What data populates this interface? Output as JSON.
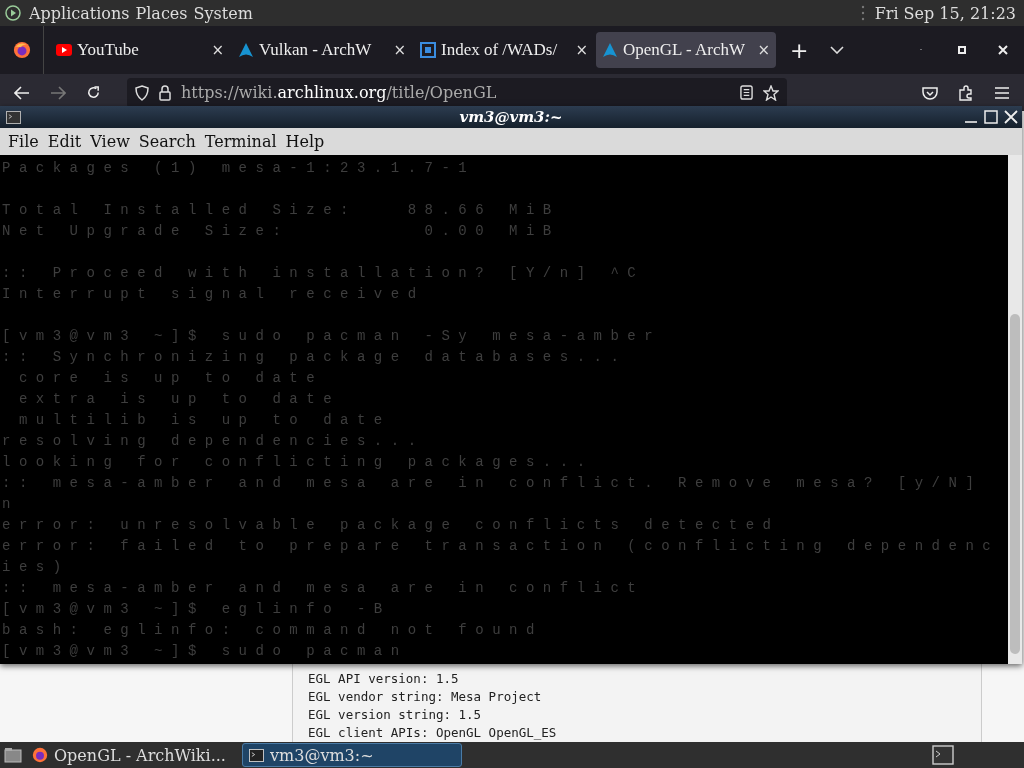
{
  "top_panel": {
    "menus": [
      "Applications",
      "Places",
      "System"
    ],
    "clock": "Fri Sep 15, 21:23"
  },
  "browser": {
    "tabs": [
      {
        "title": "YouTube",
        "selected": false
      },
      {
        "title": "Vulkan - ArchW",
        "selected": false
      },
      {
        "title": "Index of /WADs/",
        "selected": false
      },
      {
        "title": "OpenGL - ArchW",
        "selected": true
      }
    ],
    "close_glyph": "×",
    "new_tab_glyph": "+",
    "nav": {
      "back_disabled": false,
      "forward_disabled": true
    },
    "url": {
      "prefix": "https://wiki.",
      "domain": "archlinux.org",
      "path": "/title/OpenGL"
    },
    "page_lines": [
      "EGL API version: 1.5",
      "EGL vendor string: Mesa Project",
      "EGL version string: 1.5",
      "EGL client APIs: OpenGL OpenGL_ES"
    ]
  },
  "terminal": {
    "title": "vm3@vm3:~",
    "menus": [
      "File",
      "Edit",
      "View",
      "Search",
      "Terminal",
      "Help"
    ],
    "blocks": [
      {
        "lines": [
          "Packages (1) mesa-1:23.1.7-1"
        ]
      },
      {
        "lines": [
          "Total Installed Size:   88.66 MiB",
          "Net Upgrade Size:        0.00 MiB"
        ]
      },
      {
        "lines": [
          ":: Proceed with installation? [Y/n] ^C",
          "Interrupt signal received"
        ]
      },
      {
        "lines": [
          "[vm3@vm3 ~]$ sudo pacman -Sy mesa-amber",
          ":: Synchronizing package databases...",
          " core is up to date",
          " extra is up to date",
          " multilib is up to date",
          "resolving dependencies...",
          "looking for conflicting packages...",
          ":: mesa-amber and mesa are in conflict. Remove mesa? [y/N]",
          "n",
          "error: unresolvable package conflicts detected",
          "error: failed to prepare transaction (conflicting dependenc",
          "ies)",
          ":: mesa-amber and mesa are in conflict",
          "[vm3@vm3 ~]$ eglinfo -B",
          "bash: eglinfo: command not found",
          "[vm3@vm3 ~]$ sudo pacman"
        ]
      }
    ]
  },
  "taskbar": {
    "items": [
      {
        "title": "OpenGL - ArchWiki...",
        "selected": false
      },
      {
        "title": "vm3@vm3:~",
        "selected": true
      }
    ]
  }
}
